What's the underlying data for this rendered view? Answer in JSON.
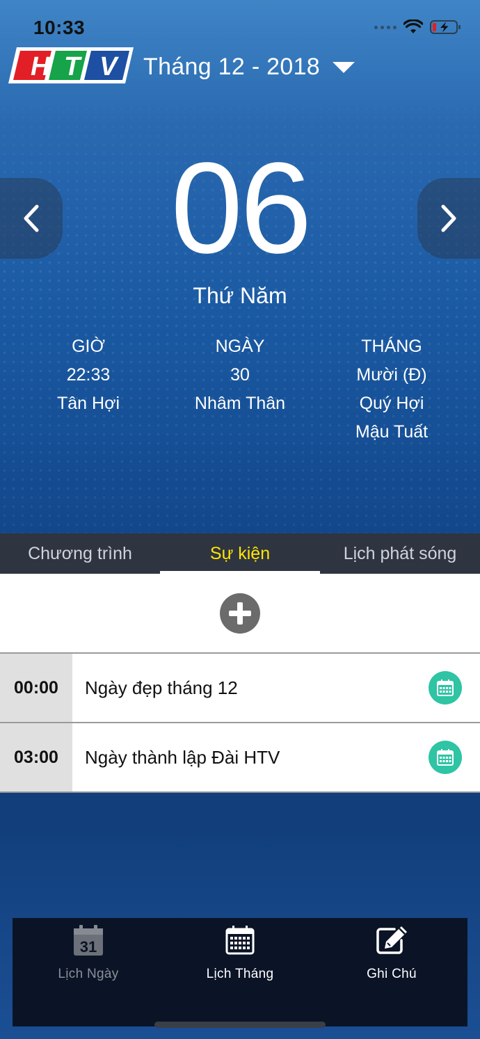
{
  "status_bar": {
    "time": "10:33"
  },
  "header": {
    "logo_text": "HTV",
    "month_label": "Tháng 12 - 2018"
  },
  "date": {
    "day": "06",
    "weekday": "Thứ Năm"
  },
  "lunar": {
    "hour": {
      "heading": "GIỜ",
      "lines": [
        "22:33",
        "Tân Hợi"
      ]
    },
    "day": {
      "heading": "NGÀY",
      "lines": [
        "30",
        "Nhâm Thân"
      ]
    },
    "month": {
      "heading": "THÁNG",
      "lines": [
        "Mười (Đ)",
        "Quý Hợi",
        "Mậu Tuất"
      ]
    }
  },
  "tabs": [
    {
      "label": "Chương trình",
      "active": false
    },
    {
      "label": "Sự kiện",
      "active": true
    },
    {
      "label": "Lịch phát sóng",
      "active": false
    }
  ],
  "events": [
    {
      "time": "00:00",
      "title": "Ngày đẹp tháng 12"
    },
    {
      "time": "03:00",
      "title": "Ngày thành lập Đài HTV"
    }
  ],
  "bottom_nav": [
    {
      "label": "Lịch Ngày",
      "icon": "day-calendar-icon",
      "active": false,
      "icon_number": "31"
    },
    {
      "label": "Lịch Tháng",
      "icon": "month-calendar-icon",
      "active": true
    },
    {
      "label": "Ghi Chú",
      "icon": "note-edit-icon",
      "active": true
    }
  ],
  "colors": {
    "active_tab": "#ffe600",
    "tab_bar": "#2f3441",
    "calendar_badge": "#2ec4a4",
    "logo_red": "#e21f26",
    "logo_green": "#16a34a",
    "logo_blue": "#1d4fa3"
  }
}
